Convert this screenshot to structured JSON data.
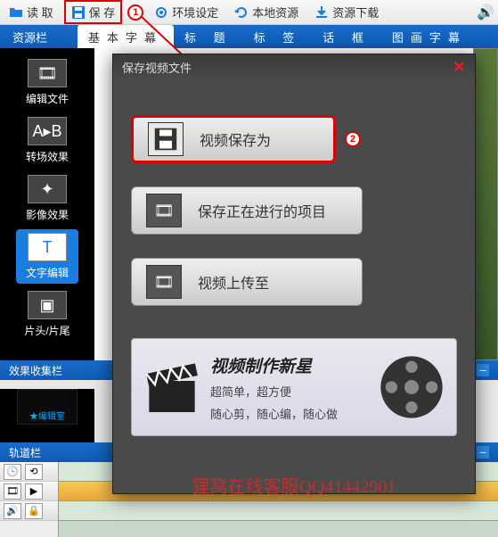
{
  "toolbar": {
    "open": "读 取",
    "save": "保 存",
    "settings": "环境设定",
    "local": "本地资源",
    "download": "资源下载"
  },
  "markers": {
    "one": "1",
    "two": "2"
  },
  "resource_bar": {
    "title": "资源栏",
    "tabs": [
      "基本字幕",
      "标 题",
      "标 签",
      "话 框",
      "图画字幕"
    ]
  },
  "sidebar": {
    "items": [
      {
        "label": "编辑文件"
      },
      {
        "label": "转场效果"
      },
      {
        "label": "影像效果"
      },
      {
        "label": "文字编辑"
      },
      {
        "label": "片头/片尾"
      }
    ]
  },
  "fx_bar": {
    "title": "效果收集栏",
    "thumb_label": "★编辑室"
  },
  "track_bar": {
    "title": "轨道栏"
  },
  "dialog": {
    "title": "保存视频文件",
    "buttons": {
      "save_as": "视频保存为",
      "save_project": "保存正在进行的项目",
      "upload": "视频上传至"
    },
    "promo": {
      "title": "视频制作新星",
      "sub1": "超简单，超方便",
      "sub2": "随心剪，随心编，随心做"
    },
    "footer": "狸窝在线客服QQ41442901"
  }
}
